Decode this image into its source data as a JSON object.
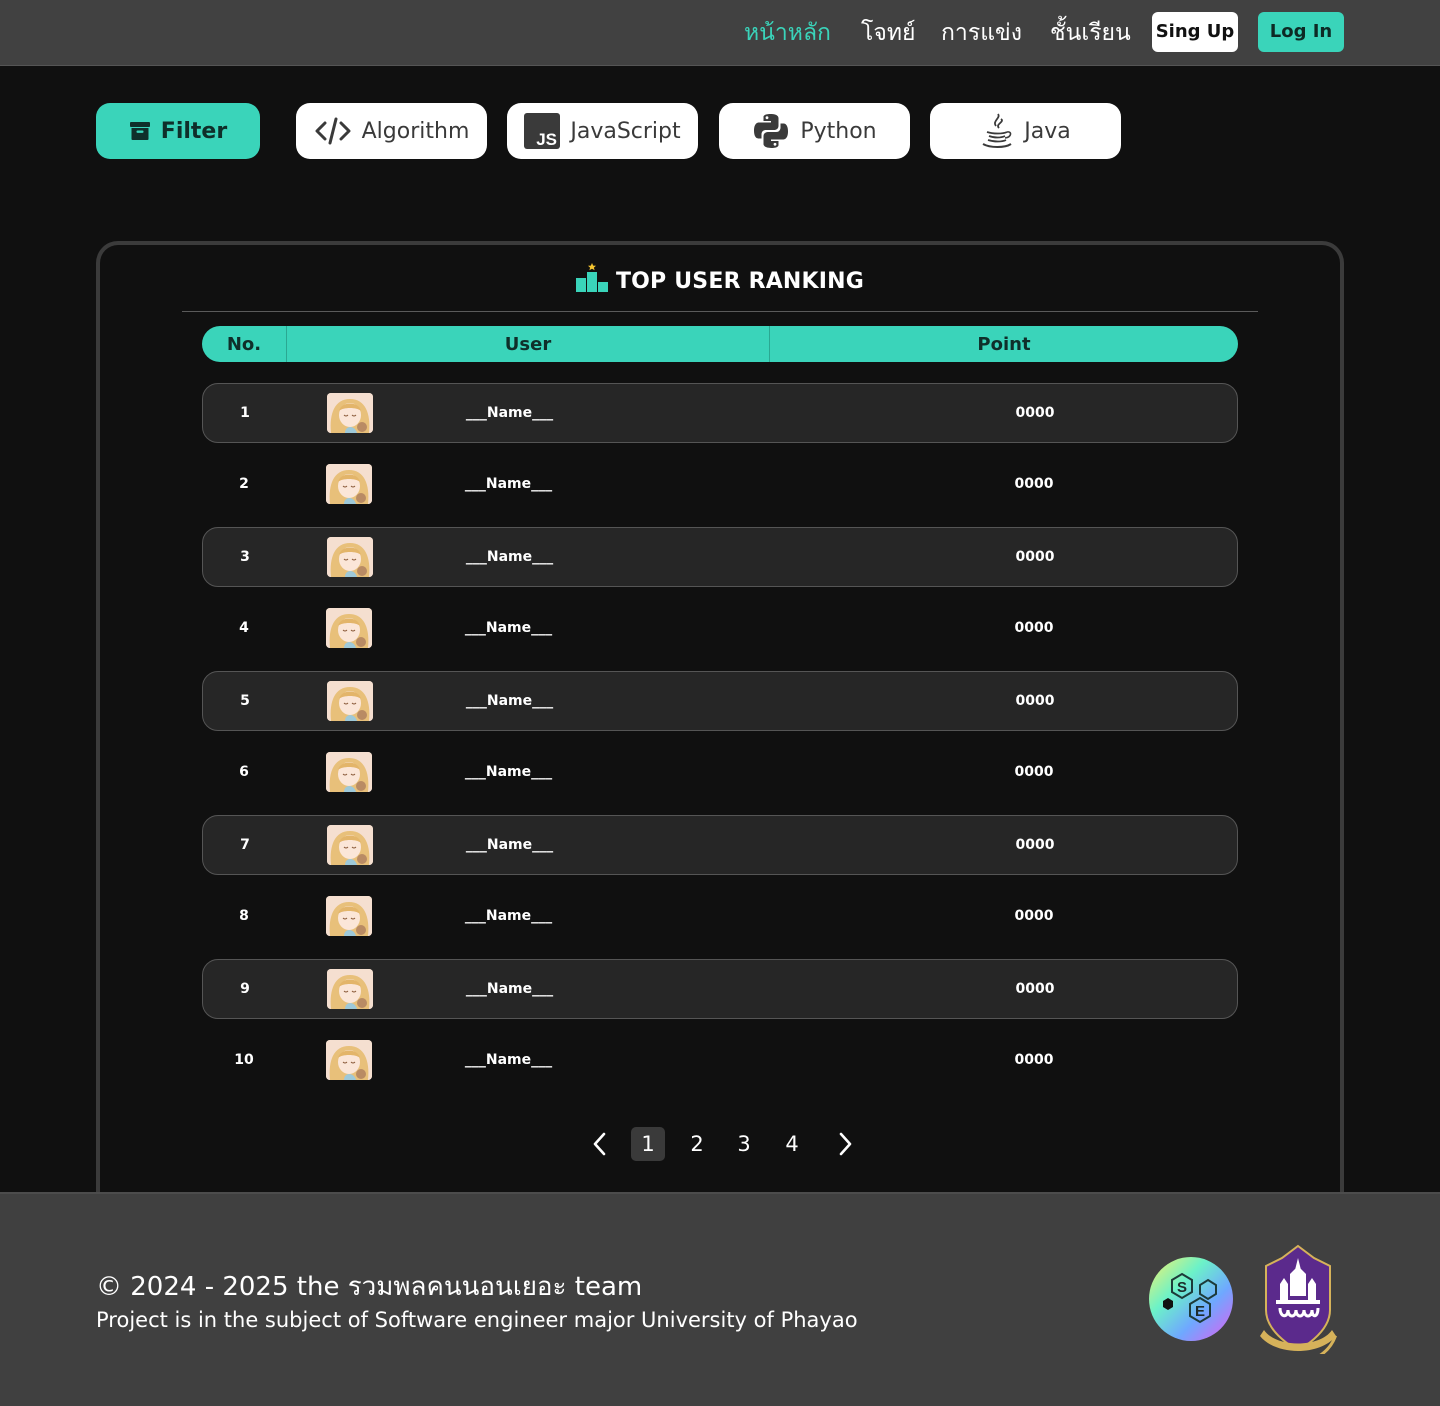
{
  "nav": {
    "links": [
      {
        "label": "หน้าหลัก",
        "active": true
      },
      {
        "label": "โจทย์",
        "active": false
      },
      {
        "label": "การแข่ง",
        "active": false
      },
      {
        "label": "ชั้นเรียน",
        "active": false
      }
    ],
    "signup_label": "Sing Up",
    "login_label": "Log In"
  },
  "filters": {
    "filter_label": "Filter",
    "categories": [
      {
        "label": "Algorithm",
        "icon": "code-icon"
      },
      {
        "label": "JavaScript",
        "icon": "javascript-icon"
      },
      {
        "label": "Python",
        "icon": "python-icon"
      },
      {
        "label": "Java",
        "icon": "java-icon"
      }
    ]
  },
  "ranking": {
    "title": "TOP USER RANKING",
    "columns": {
      "no": "No.",
      "user": "User",
      "point": "Point"
    },
    "rows": [
      {
        "no": "1",
        "name": "___Name___",
        "point": "0000"
      },
      {
        "no": "2",
        "name": "___Name___",
        "point": "0000"
      },
      {
        "no": "3",
        "name": "___Name___",
        "point": "0000"
      },
      {
        "no": "4",
        "name": "___Name___",
        "point": "0000"
      },
      {
        "no": "5",
        "name": "___Name___",
        "point": "0000"
      },
      {
        "no": "6",
        "name": "___Name___",
        "point": "0000"
      },
      {
        "no": "7",
        "name": "___Name___",
        "point": "0000"
      },
      {
        "no": "8",
        "name": "___Name___",
        "point": "0000"
      },
      {
        "no": "9",
        "name": "___Name___",
        "point": "0000"
      },
      {
        "no": "10",
        "name": "___Name___",
        "point": "0000"
      }
    ]
  },
  "pagination": {
    "pages": [
      "1",
      "2",
      "3",
      "4"
    ],
    "current": "1"
  },
  "footer": {
    "copyright": "© 2024 - 2025 the รวมพลคนนอนเยอะ team",
    "subtitle": "Project is in the subject of Software engineer major University of Phayao",
    "se_logo_letters": "S E",
    "up_logo_text": "มหาวิทยาลัยพะเยา"
  },
  "colors": {
    "accent": "#3ad4ba",
    "background": "#101010",
    "bar": "#414141",
    "row_alt": "#262626"
  }
}
